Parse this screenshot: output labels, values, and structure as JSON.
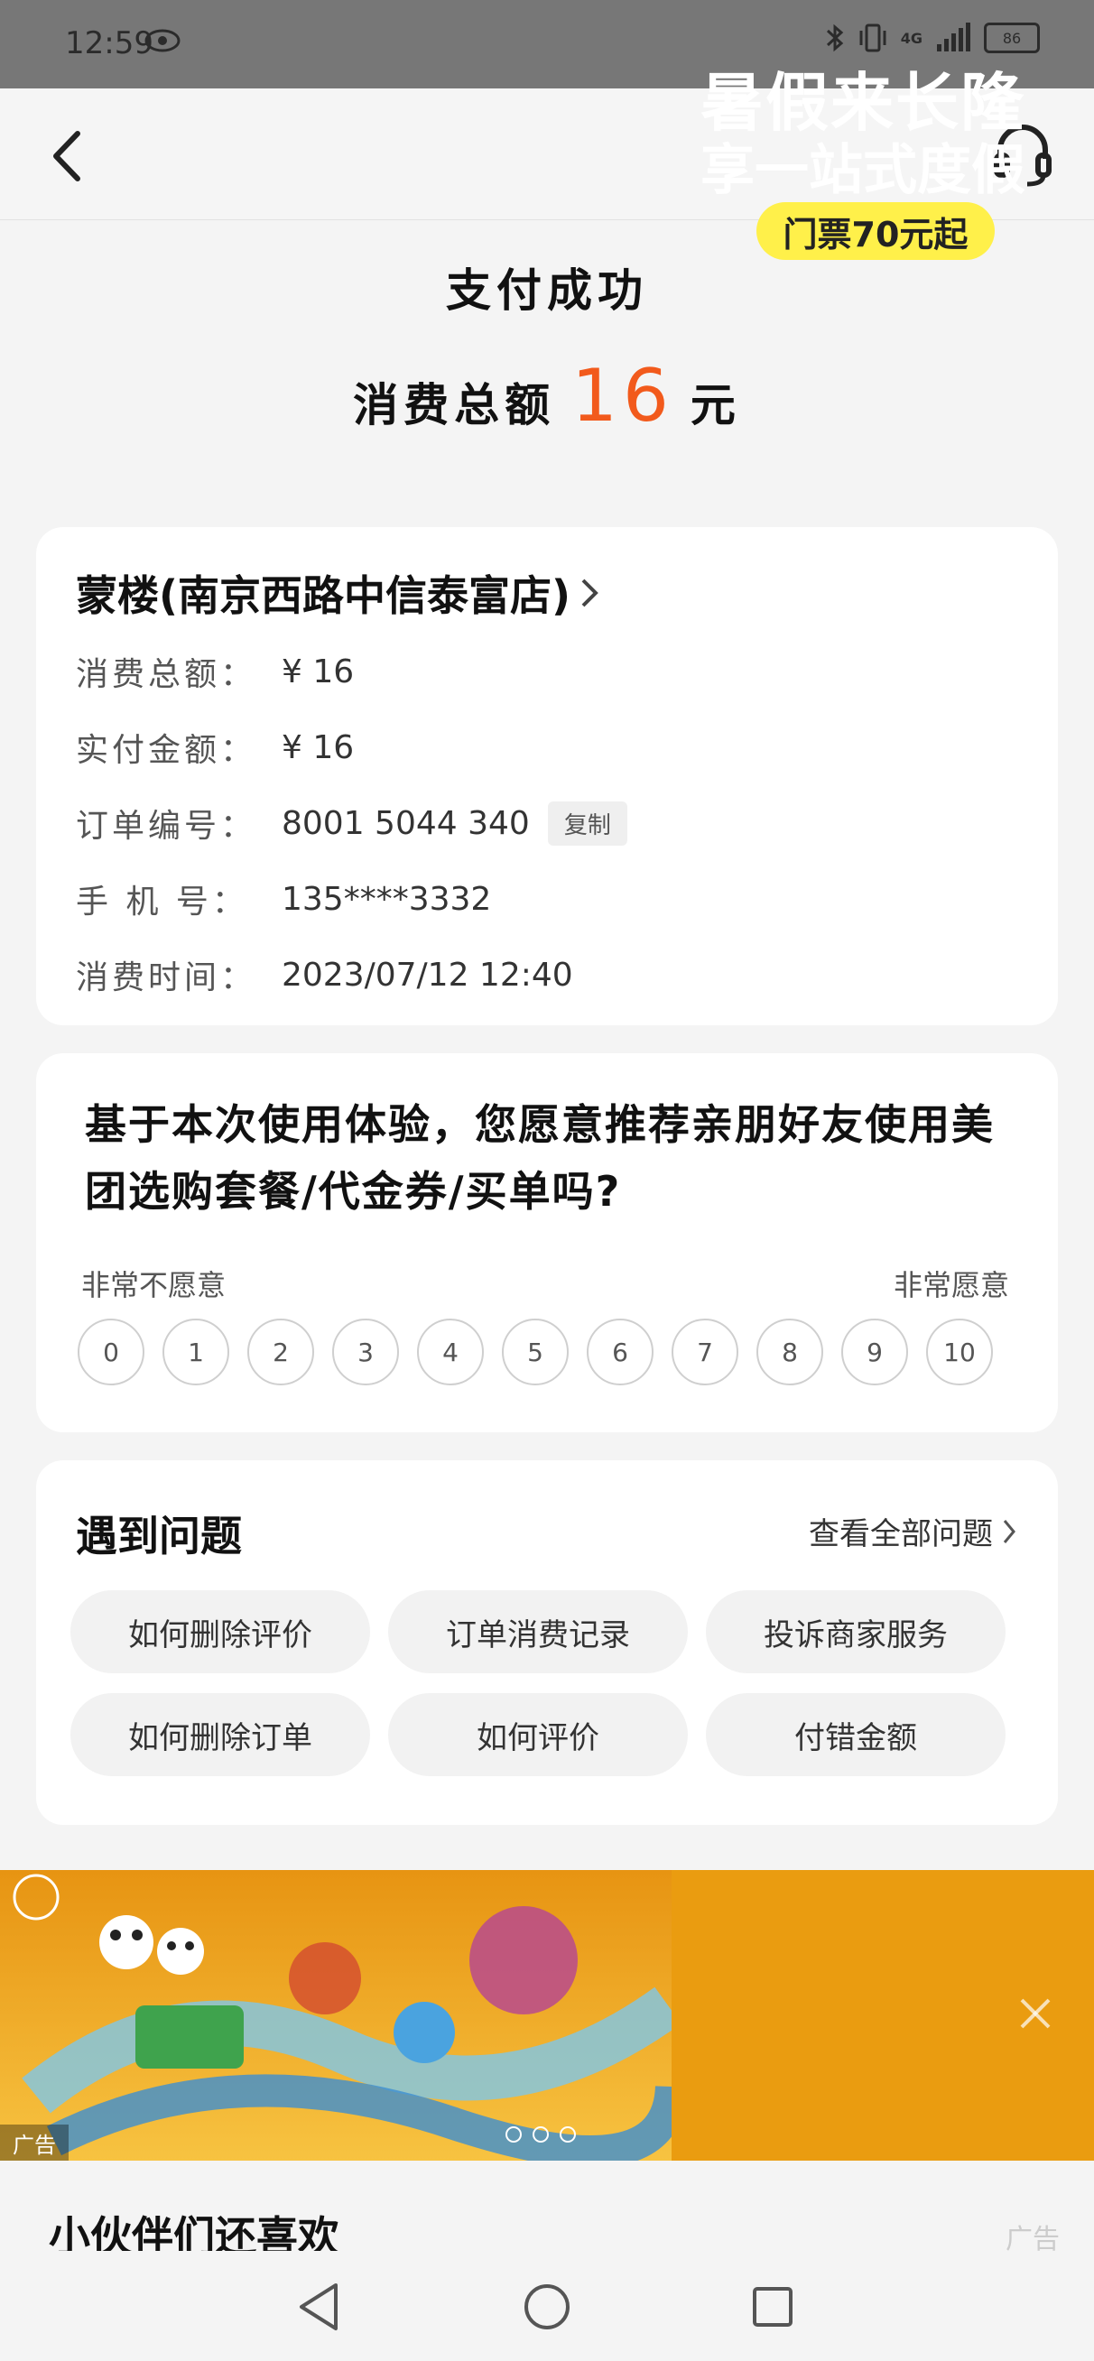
{
  "status": {
    "time": "12:59",
    "network": "4G",
    "battery": "86"
  },
  "page": {
    "title": "支付成功",
    "total_label": "消费总额",
    "total_amount": "16",
    "total_unit": "元"
  },
  "order": {
    "store": "蒙楼(南京西路中信泰富店)",
    "rows": [
      {
        "label": "消费总额：",
        "value": "¥ 16"
      },
      {
        "label": "实付金额：",
        "value": "¥ 16"
      },
      {
        "label": "订单编号：",
        "value": "8001 5044 340"
      },
      {
        "label": "手 机 号：",
        "value": "135****3332"
      },
      {
        "label": "消费时间：",
        "value": "2023/07/12 12:40"
      }
    ],
    "copy_label": "复制"
  },
  "survey": {
    "question": "基于本次使用体验，您愿意推荐亲朋好友使用美团选购套餐/代金券/买单吗?",
    "low_label": "非常不愿意",
    "high_label": "非常愿意",
    "scale": [
      "0",
      "1",
      "2",
      "3",
      "4",
      "5",
      "6",
      "7",
      "8",
      "9",
      "10"
    ]
  },
  "help": {
    "title": "遇到问题",
    "view_all": "查看全部问题",
    "chips": [
      "如何删除评价",
      "订单消费记录",
      "投诉商家服务",
      "如何删除订单",
      "如何评价",
      "付错金额"
    ]
  },
  "banner": {
    "headline": "暑假来长隆",
    "subhead": "享一站式度假",
    "button": "门票70元起",
    "ad_tag": "广告"
  },
  "recommend": {
    "title": "小伙伴们还喜欢",
    "ad_label": "广告"
  }
}
